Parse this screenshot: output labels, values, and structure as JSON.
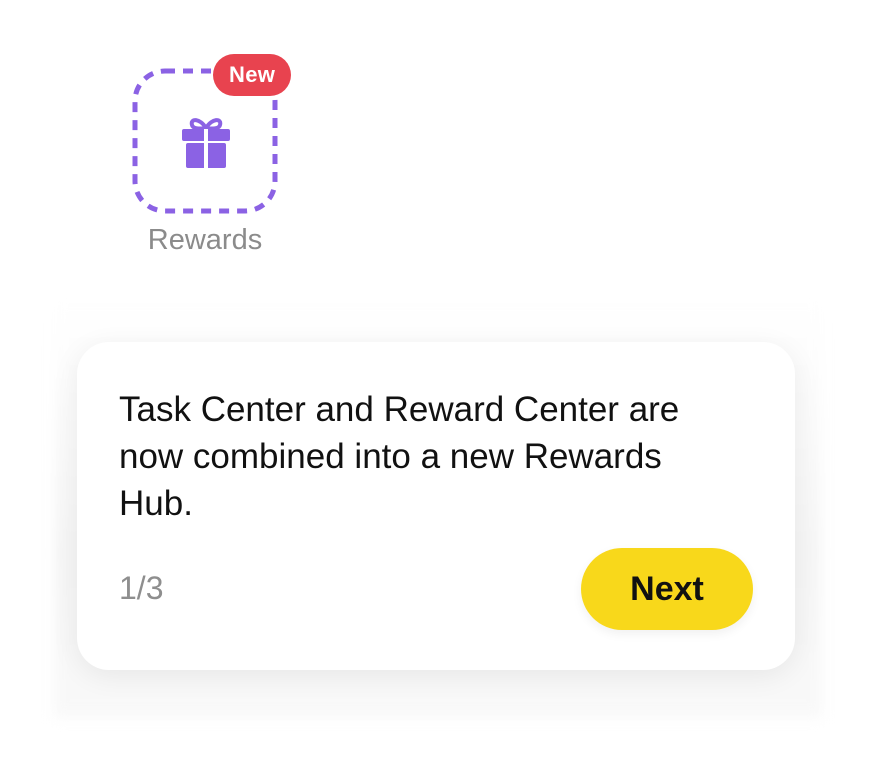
{
  "rewards_entry": {
    "badge_label": "New",
    "label": "Rewards",
    "icon": "gift-icon"
  },
  "tooltip": {
    "message": "Task Center and Reward Center are now combined into a new Rewards Hub.",
    "step": "1/3",
    "next_label": "Next"
  },
  "colors": {
    "accent_purple": "#8b62e4",
    "badge_red": "#e8434f",
    "button_yellow": "#f8d81b",
    "muted_text": "#8b8b8b"
  }
}
